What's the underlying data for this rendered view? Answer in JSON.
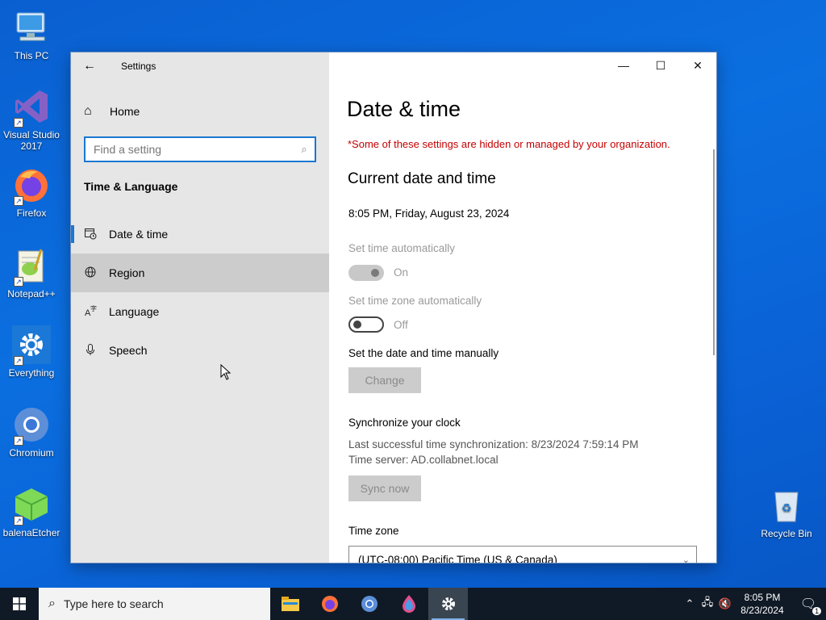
{
  "desktop": {
    "icons": [
      {
        "label": "This PC"
      },
      {
        "label": "Visual Studio 2017"
      },
      {
        "label": "Firefox"
      },
      {
        "label": "Notepad++"
      },
      {
        "label": "Everything"
      },
      {
        "label": "Chromium"
      },
      {
        "label": "balenaEtcher"
      },
      {
        "label": "Recycle Bin"
      }
    ]
  },
  "window": {
    "title": "Settings",
    "nav": {
      "home_label": "Home",
      "search_placeholder": "Find a setting",
      "section_title": "Time & Language",
      "items": [
        {
          "label": "Date & time",
          "icon": "clock-calendar-icon",
          "selected": true
        },
        {
          "label": "Region",
          "icon": "globe-icon",
          "hovered": true
        },
        {
          "label": "Language",
          "icon": "language-icon"
        },
        {
          "label": "Speech",
          "icon": "microphone-icon"
        }
      ]
    },
    "content": {
      "page_title": "Date & time",
      "warning": "*Some of these settings are hidden or managed by your organization.",
      "section_title": "Current date and time",
      "current_datetime": "8:05 PM, Friday, August 23, 2024",
      "set_time_auto": {
        "label": "Set time automatically",
        "state": "On",
        "on": true,
        "disabled": true
      },
      "set_timezone_auto": {
        "label": "Set time zone automatically",
        "state": "Off",
        "on": false
      },
      "manual": {
        "label": "Set the date and time manually",
        "button": "Change"
      },
      "sync": {
        "title": "Synchronize your clock",
        "last_sync": "Last successful time synchronization: 8/23/2024 7:59:14 PM",
        "server": "Time server: AD.collabnet.local",
        "button": "Sync now"
      },
      "timezone": {
        "label": "Time zone",
        "value": "(UTC-08:00) Pacific Time (US & Canada)"
      }
    }
  },
  "taskbar": {
    "search_placeholder": "Type here to search",
    "apps": [
      "file-explorer-icon",
      "firefox-icon",
      "chromium-icon",
      "balena-etcher-icon",
      "settings-icon"
    ],
    "clock_time": "8:05 PM",
    "clock_date": "8/23/2024",
    "notification_count": "1"
  },
  "colors": {
    "accent": "#1a78d2",
    "warning": "#c40000",
    "desktop": "#0b6fe0",
    "taskbar": "#101a26"
  }
}
